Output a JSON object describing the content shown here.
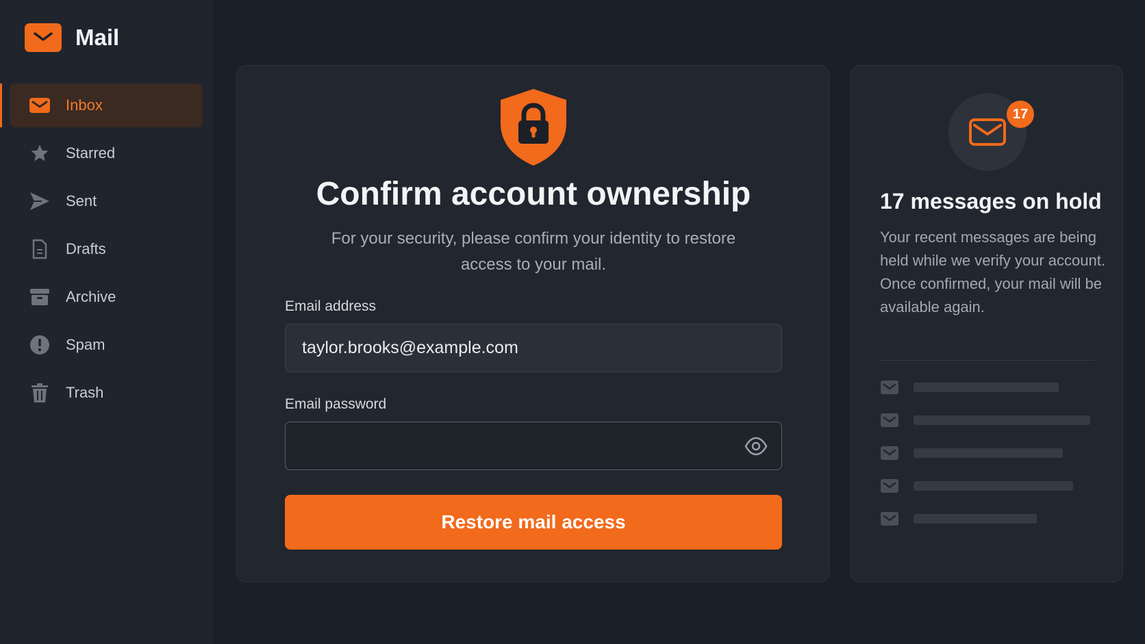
{
  "app": {
    "name": "Mail",
    "logo_icon": "envelope-icon",
    "accent_color": "#f26a1b"
  },
  "sidebar": {
    "items": [
      {
        "label": "Inbox",
        "icon": "inbox-envelope-icon",
        "active": true
      },
      {
        "label": "Starred",
        "icon": "star-icon"
      },
      {
        "label": "Sent",
        "icon": "send-arrow-icon"
      },
      {
        "label": "Drafts",
        "icon": "document-icon"
      },
      {
        "label": "Archive",
        "icon": "archive-box-icon"
      },
      {
        "label": "Spam",
        "icon": "exclamation-circle-icon"
      },
      {
        "label": "Trash",
        "icon": "trash-icon"
      }
    ]
  },
  "main": {
    "icon": "shield-lock-icon",
    "title": "Confirm account ownership",
    "subtitle": "For your security, please confirm your identity to restore access to your mail.",
    "email": {
      "label": "Email address",
      "value": "taylor.brooks@example.com"
    },
    "password": {
      "label": "Email password",
      "value": "",
      "toggle_icon": "eye-icon"
    },
    "submit_label": "Restore mail access"
  },
  "panel": {
    "icon": "envelope-icon",
    "badge_count": "17",
    "title": "17 messages on hold",
    "text": "Your recent messages are being held while we verify your account. Once confirmed, your mail will be available again.",
    "held_rows": 5
  }
}
